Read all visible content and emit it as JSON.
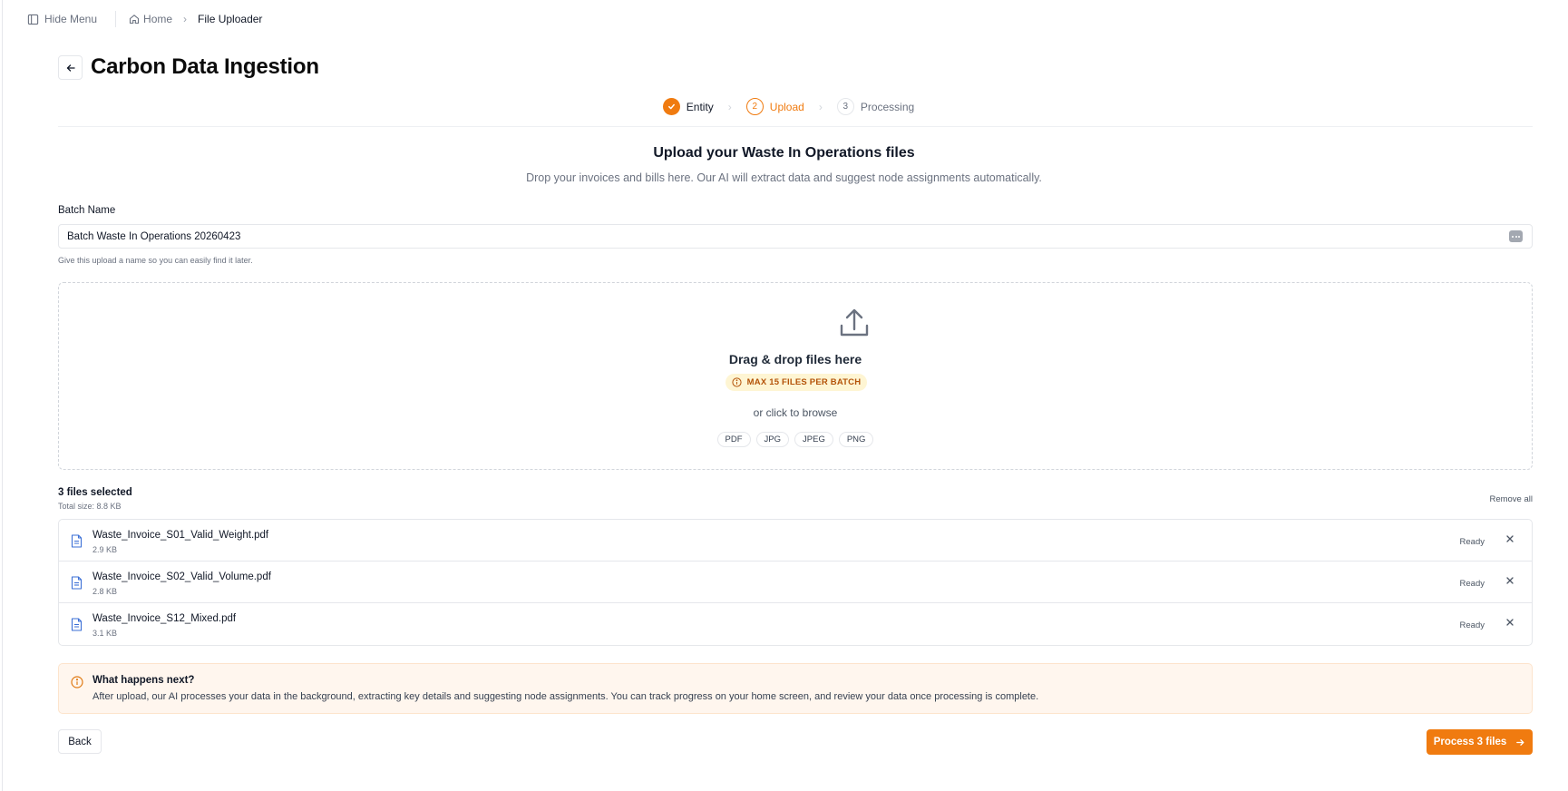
{
  "topbar": {
    "hide_menu_label": "Hide Menu",
    "breadcrumb": {
      "home": "Home",
      "current": "File Uploader"
    }
  },
  "header": {
    "title": "Carbon Data Ingestion"
  },
  "stepper": {
    "steps": [
      {
        "number": "1",
        "label": "Entity",
        "state": "done"
      },
      {
        "number": "2",
        "label": "Upload",
        "state": "active"
      },
      {
        "number": "3",
        "label": "Processing",
        "state": "todo"
      }
    ]
  },
  "upload": {
    "title": "Upload your Waste In Operations files",
    "subtitle": "Drop your invoices and bills here. Our AI will extract data and suggest node assignments automatically."
  },
  "batch": {
    "label": "Batch Name",
    "value": "Batch Waste In Operations 20260423",
    "help": "Give this upload a name so you can easily find it later."
  },
  "dropzone": {
    "title": "Drag & drop files here",
    "badge": "MAX 15 FILES PER BATCH",
    "browse": "or click to browse",
    "types": [
      "PDF",
      "JPG",
      "JPEG",
      "PNG"
    ]
  },
  "files": {
    "count_label": "3 files selected",
    "total_size": "Total size: 8.8 KB",
    "remove_all": "Remove all",
    "items": [
      {
        "name": "Waste_Invoice_S01_Valid_Weight.pdf",
        "size": "2.9 KB",
        "status": "Ready"
      },
      {
        "name": "Waste_Invoice_S02_Valid_Volume.pdf",
        "size": "2.8 KB",
        "status": "Ready"
      },
      {
        "name": "Waste_Invoice_S12_Mixed.pdf",
        "size": "3.1 KB",
        "status": "Ready"
      }
    ]
  },
  "info": {
    "title": "What happens next?",
    "body": "After upload, our AI processes your data in the background, extracting key details and suggesting node assignments. You can track progress on your home screen, and review your data once processing is complete."
  },
  "footer": {
    "back_label": "Back",
    "process_label": "Process 3 files"
  },
  "colors": {
    "accent": "#f07b10",
    "badge_bg": "#fef5d3",
    "info_bg": "#fff6ee"
  }
}
